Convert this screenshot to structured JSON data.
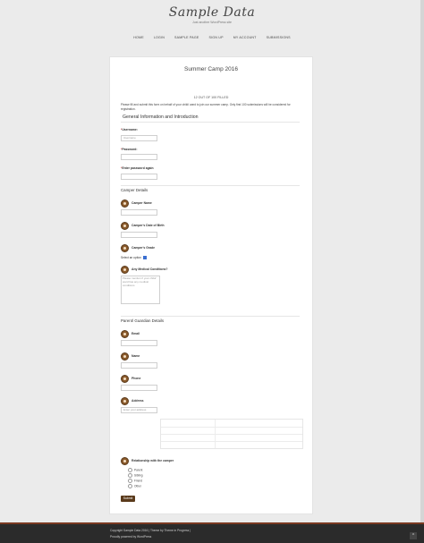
{
  "site": {
    "title": "Sample Data",
    "tagline": "Just another WordPress site",
    "nav": [
      "HOME",
      "LOGIN",
      "SAMPLE PAGE",
      "SIGN UP",
      "MY ACCOUNT",
      "SUBMISSIONS"
    ]
  },
  "form": {
    "title": "Summer Camp 2016",
    "progress": "12 OUT OF 100 FILLED",
    "intro": "Please fill and submit this form on behalf of your child/ ward to join our summer camp. Only first 100 submissions will be considered for registration.",
    "section_general": "General Information and Introduction",
    "username_label": "Username:",
    "username_placeholder": "Username",
    "password_label": "Password:",
    "password_again_label": "Enter password again",
    "camper_section": "Camper Details",
    "camper_name_label": "Camper Name",
    "camper_dob_label": "Camper's Date of Birth",
    "camper_grade_label": "Camper's Grade",
    "grade_select": "Select an option",
    "medical_label": "Any Medical Conditions?",
    "medical_placeholder": "Please mention if your child/ ward has any medical conditions",
    "parent_section": "Parent/ Guardian Details",
    "email_label": "Email",
    "name_label": "Name",
    "phone_label": "Phone",
    "address_label": "Address",
    "address_placeholder": "Enter your address",
    "relationship_label": "Relationship with the camper",
    "relationship_options": [
      "Parent",
      "Sibling",
      "Friend",
      "Other"
    ],
    "submit_label": "Submit",
    "required_mark": "*"
  },
  "footer": {
    "line1": "Copyright Sample Data 2016 | Theme by Theme in Progress |",
    "line2": "Proudly powered by WordPress"
  },
  "icons": {
    "scroll_top": "^"
  }
}
